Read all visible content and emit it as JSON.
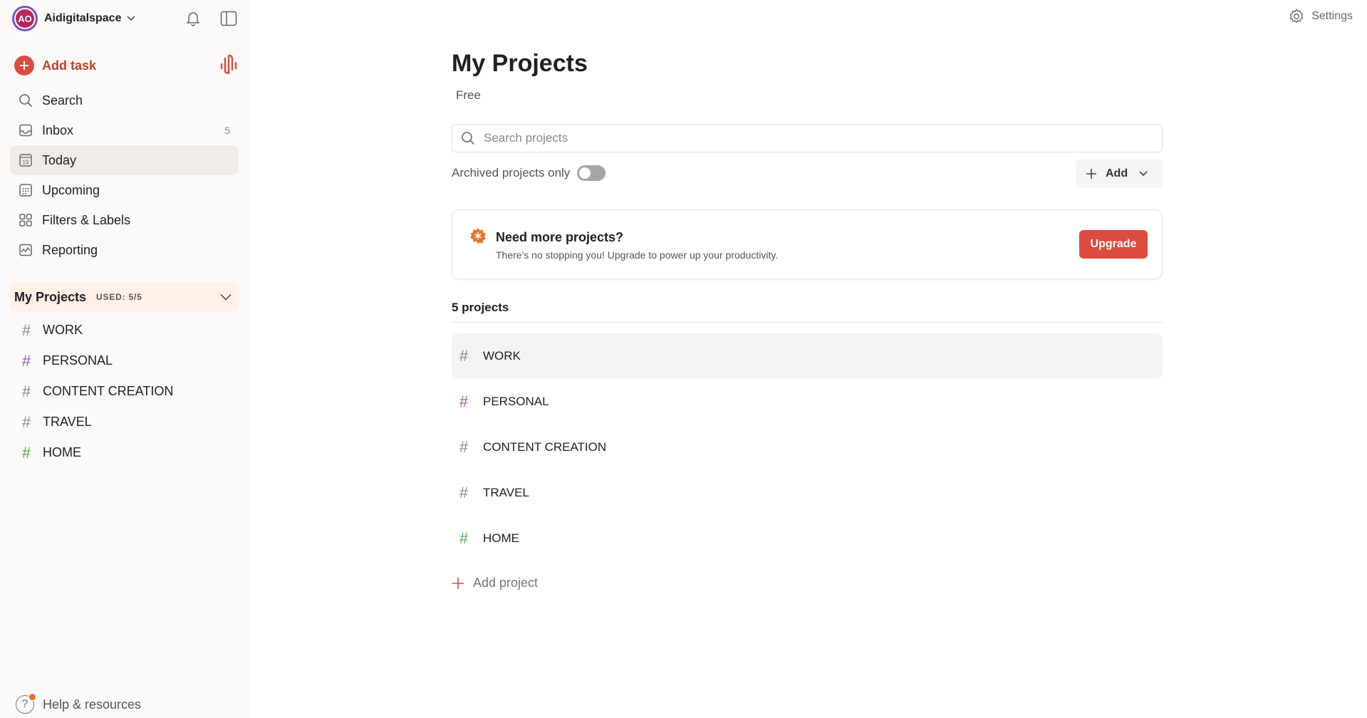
{
  "workspace": {
    "initials": "AO",
    "name": "Aidigitalspace"
  },
  "sidebar": {
    "add_task": "Add task",
    "nav": [
      {
        "label": "Search",
        "icon": "search-icon"
      },
      {
        "label": "Inbox",
        "icon": "inbox-icon",
        "count": "5"
      },
      {
        "label": "Today",
        "icon": "calendar-today-icon",
        "day": "19"
      },
      {
        "label": "Upcoming",
        "icon": "calendar-grid-icon"
      },
      {
        "label": "Filters & Labels",
        "icon": "filters-icon"
      },
      {
        "label": "Reporting",
        "icon": "reporting-icon"
      }
    ],
    "projects_header": {
      "title": "My Projects",
      "used": "USED: 5/5"
    },
    "projects": [
      {
        "name": "WORK",
        "color": "#8a8a8a"
      },
      {
        "name": "PERSONAL",
        "color": "#9b59b6"
      },
      {
        "name": "CONTENT CREATION",
        "color": "#8a8a8a"
      },
      {
        "name": "TRAVEL",
        "color": "#8a8a8a"
      },
      {
        "name": "HOME",
        "color": "#4caf50"
      }
    ],
    "help": "Help & resources"
  },
  "header": {
    "settings": "Settings"
  },
  "main": {
    "title": "My Projects",
    "plan": "Free",
    "search_placeholder": "Search projects",
    "archived_label": "Archived projects only",
    "add_label": "Add",
    "promo": {
      "title": "Need more projects?",
      "description": "There's no stopping you! Upgrade to power up your productivity.",
      "button": "Upgrade"
    },
    "project_count": "5 projects",
    "projects": [
      {
        "name": "WORK",
        "color": "#8a8a8a"
      },
      {
        "name": "PERSONAL",
        "color": "#9b59b6"
      },
      {
        "name": "CONTENT CREATION",
        "color": "#8a8a8a"
      },
      {
        "name": "TRAVEL",
        "color": "#8a8a8a"
      },
      {
        "name": "HOME",
        "color": "#4caf50"
      }
    ],
    "add_project": "Add project"
  },
  "colors": {
    "accent": "#dc4c3e",
    "active_bg": "#f0ebe7",
    "projects_header_bg": "#fff0e8"
  }
}
